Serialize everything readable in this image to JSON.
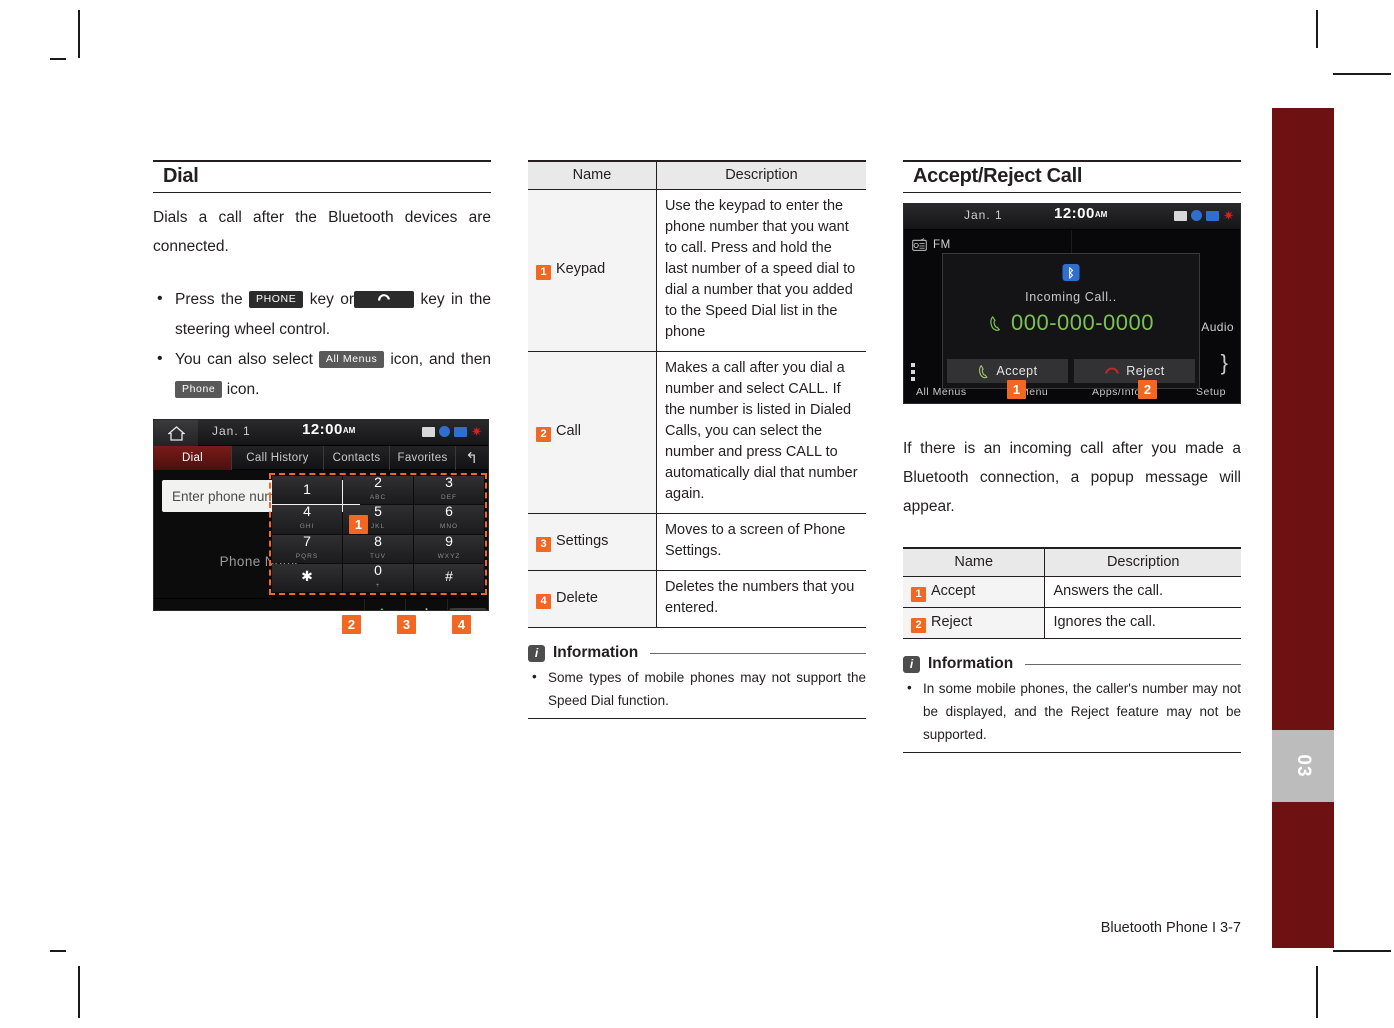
{
  "page": {
    "footer": "Bluetooth Phone I 3-7",
    "edge_tab_number": "03",
    "accent_color": "#f26722",
    "tab_color": "#6d1113"
  },
  "dial_section": {
    "heading": "Dial",
    "intro": "Dials a call after the Bluetooth devices are connected.",
    "bullets": [
      {
        "pre": "Press the",
        "chip1": "PHONE",
        "mid": "key or",
        "chip2": "call-icon",
        "post": "key in the steering wheel control."
      },
      {
        "pre": "You can also select",
        "chip1": "All Menus",
        "mid": "icon, and then",
        "chip2": "Phone",
        "post": "icon."
      }
    ],
    "screen": {
      "status": {
        "home_icon": "home-icon",
        "date": "Jan.  1",
        "time": "12:00",
        "ampm": "AM",
        "icons": [
          "battery-icon",
          "bluetooth-icon",
          "signal-icon",
          "asterisk-icon"
        ]
      },
      "tabs": [
        {
          "label": "Dial",
          "active": true
        },
        {
          "label": "Call History",
          "active": false
        },
        {
          "label": "Contacts",
          "active": false
        },
        {
          "label": "Favorites",
          "active": false
        }
      ],
      "back_icon": "back-arrow-icon",
      "input_placeholder": "Enter phone number.",
      "phone_name": "Phone Name",
      "keypad": [
        {
          "digit": "1",
          "sub": ""
        },
        {
          "digit": "2",
          "sub": "ABC"
        },
        {
          "digit": "3",
          "sub": "DEF"
        },
        {
          "digit": "4",
          "sub": "GHI"
        },
        {
          "digit": "5",
          "sub": "JKL"
        },
        {
          "digit": "6",
          "sub": "MNO"
        },
        {
          "digit": "7",
          "sub": "PQRS"
        },
        {
          "digit": "8",
          "sub": "TUV"
        },
        {
          "digit": "9",
          "sub": "WXYZ"
        },
        {
          "digit": "✱",
          "sub": ""
        },
        {
          "digit": "0",
          "sub": "+"
        },
        {
          "digit": "#",
          "sub": ""
        }
      ],
      "actions": [
        {
          "icon": "call-icon",
          "badge": "2"
        },
        {
          "icon": "gear-icon",
          "badge": "3"
        },
        {
          "icon": "delete-icon",
          "badge": "4"
        }
      ],
      "keypad_badge": "1"
    }
  },
  "dial_table": {
    "headers": [
      "Name",
      "Description"
    ],
    "rows": [
      {
        "badge": "1",
        "name": "Keypad",
        "description": "Use the keypad to enter the phone number that you want to call. Press and hold the last number of a speed dial to dial a number that you added to the Speed Dial list in the phone"
      },
      {
        "badge": "2",
        "name": "Call",
        "description": "Makes a call after you dial a number and select CALL. If the number is listed in Dialed Calls, you can select the number and press CALL to automatically dial that number again."
      },
      {
        "badge": "3",
        "name": "Settings",
        "description": "Moves to a screen of Phone Settings."
      },
      {
        "badge": "4",
        "name": "Delete",
        "description": "Deletes the numbers that you entered."
      }
    ]
  },
  "dial_info": {
    "title": "Information",
    "icon": "info-icon",
    "items": [
      "Some types of mobile phones may not support the Speed Dial function."
    ]
  },
  "accept_section": {
    "heading": "Accept/Reject Call",
    "paragraph": "If there is an incoming call after you made a Bluetooth connection, a popup message will appear.",
    "screen": {
      "status": {
        "date": "Jan.  1",
        "time": "12:00",
        "ampm": "AM",
        "icons": [
          "battery-icon",
          "bluetooth-icon",
          "signal-icon",
          "asterisk-icon"
        ]
      },
      "source_label": "FM",
      "source_icon": "radio-icon",
      "popup": {
        "bluetooth_icon": "bluetooth-icon",
        "title": "Incoming Call..",
        "number": "000-000-0000",
        "number_icon": "call-incoming-icon",
        "accept_label": "Accept",
        "accept_icon": "call-accept-icon",
        "reject_label": "Reject",
        "reject_icon": "call-reject-icon",
        "accept_badge": "1",
        "reject_badge": "2"
      },
      "nav": [
        "All Menus",
        "Menu",
        "Apps/Info",
        "Setup"
      ],
      "right_label": "Audio"
    }
  },
  "accept_table": {
    "headers": [
      "Name",
      "Description"
    ],
    "rows": [
      {
        "badge": "1",
        "name": "Accept",
        "description": "Answers the call."
      },
      {
        "badge": "2",
        "name": "Reject",
        "description": "Ignores the call."
      }
    ]
  },
  "accept_info": {
    "title": "Information",
    "icon": "info-icon",
    "items": [
      "In some mobile phones, the caller's number may not be displayed, and the Reject feature may not be supported."
    ]
  }
}
